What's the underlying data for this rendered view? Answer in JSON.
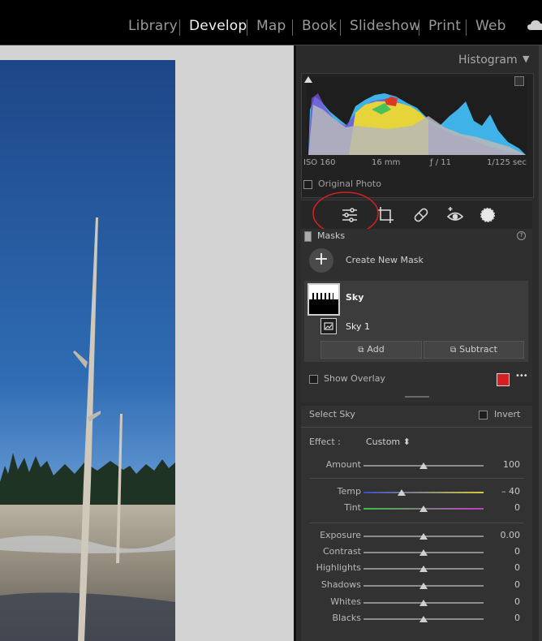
{
  "modules": [
    "Library",
    "Develop",
    "Map",
    "Book",
    "Slideshow",
    "Print",
    "Web"
  ],
  "active_module": "Develop",
  "histogram": {
    "title": "Histogram",
    "iso": "ISO 160",
    "focal": "16 mm",
    "aperture": "ƒ / 11",
    "shutter": "1/125 sec",
    "original_photo_label": "Original Photo"
  },
  "masks": {
    "title": "Masks",
    "create_label": "Create New Mask",
    "mask_name": "Sky",
    "component_name": "Sky 1",
    "add_label": "Add",
    "subtract_label": "Subtract",
    "show_overlay_label": "Show Overlay",
    "overlay_color": "#d81e1e",
    "more_label": "•••"
  },
  "adjust": {
    "select_label": "Select Sky",
    "invert_label": "Invert",
    "effect_label": "Effect :",
    "effect_value": "Custom ⬍",
    "sliders": [
      {
        "label": "Amount",
        "value": "100",
        "pos": 0.5
      },
      {
        "label": "Temp",
        "value": "– 40",
        "pos": 0.32
      },
      {
        "label": "Tint",
        "value": "0",
        "pos": 0.5
      },
      {
        "label": "Exposure",
        "value": "0.00",
        "pos": 0.5
      },
      {
        "label": "Contrast",
        "value": "0",
        "pos": 0.5
      },
      {
        "label": "Highlights",
        "value": "0",
        "pos": 0.5
      },
      {
        "label": "Shadows",
        "value": "0",
        "pos": 0.5
      },
      {
        "label": "Whites",
        "value": "0",
        "pos": 0.5
      },
      {
        "label": "Blacks",
        "value": "0",
        "pos": 0.5
      }
    ]
  }
}
